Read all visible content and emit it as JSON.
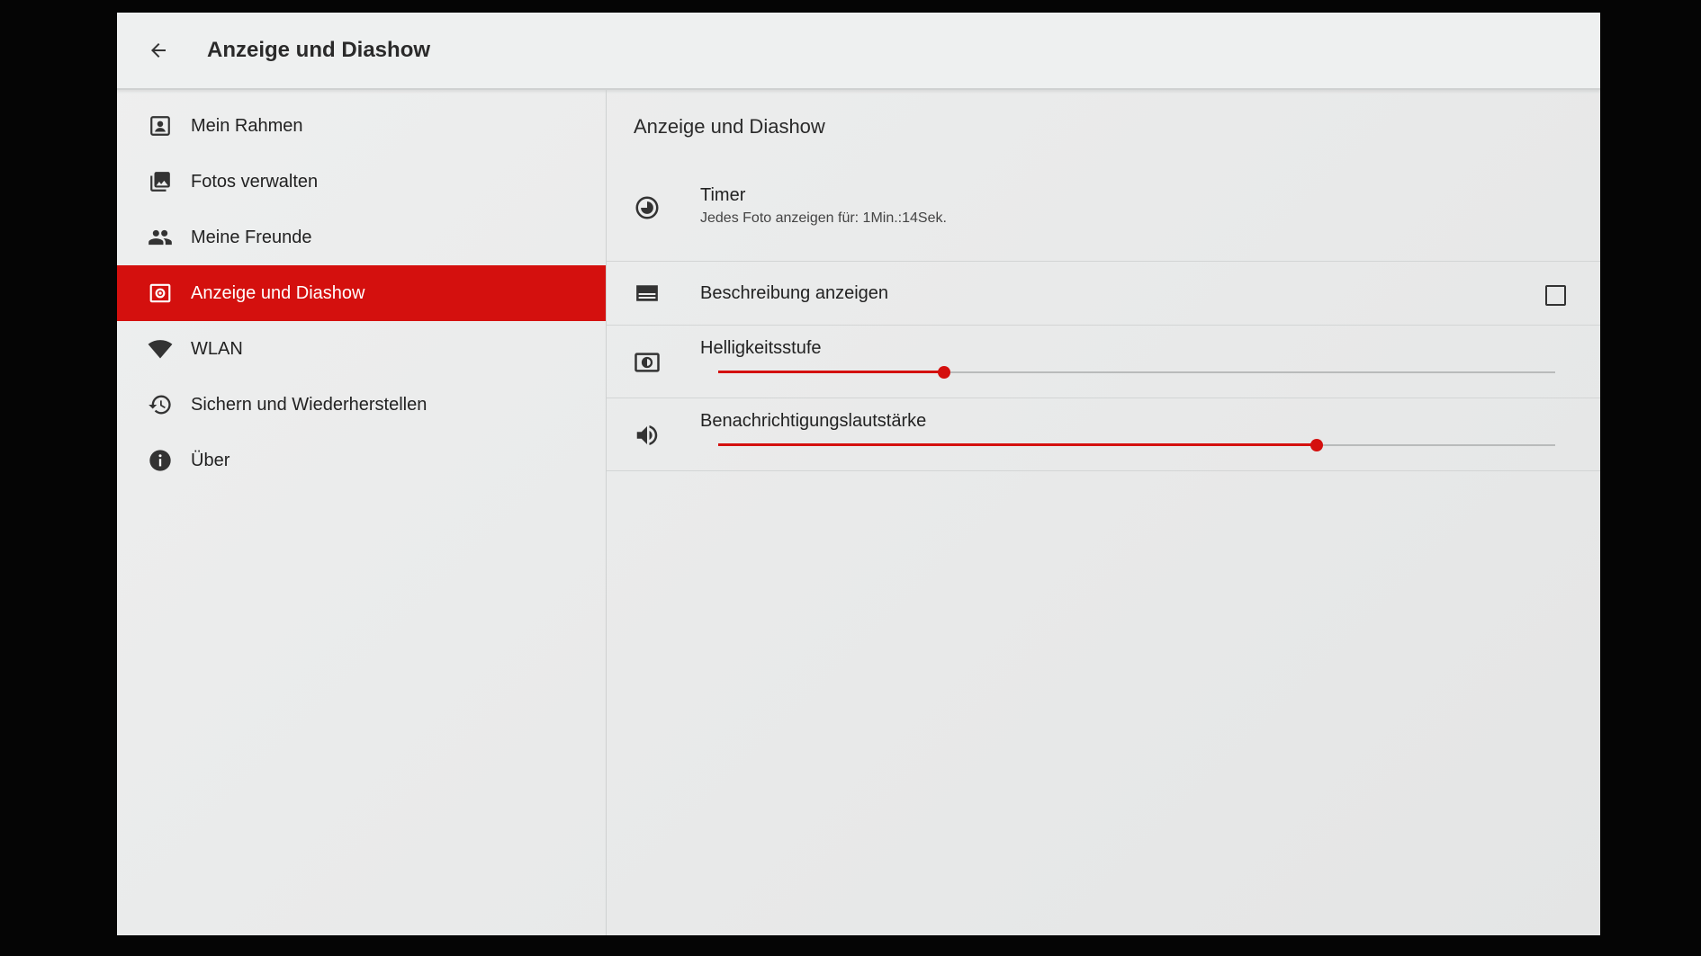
{
  "header": {
    "title": "Anzeige und Diashow"
  },
  "sidebar": {
    "items": [
      {
        "label": "Mein Rahmen",
        "icon": "portrait-frame-icon"
      },
      {
        "label": "Fotos verwalten",
        "icon": "photo-library-icon"
      },
      {
        "label": "Meine Freunde",
        "icon": "people-icon"
      },
      {
        "label": "Anzeige und Diashow",
        "icon": "display-settings-icon",
        "active": true
      },
      {
        "label": "WLAN",
        "icon": "wifi-icon"
      },
      {
        "label": "Sichern und Wiederherstellen",
        "icon": "backup-restore-icon"
      },
      {
        "label": "Über",
        "icon": "info-icon"
      }
    ]
  },
  "main": {
    "section_title": "Anzeige und Diashow",
    "timer": {
      "title": "Timer",
      "subtitle": "Jedes Foto anzeigen für: 1Min.:14Sek.",
      "icon": "timer-icon"
    },
    "description": {
      "title": "Beschreibung anzeigen",
      "checked": false,
      "icon": "subtitles-icon"
    },
    "brightness": {
      "title": "Helligkeitsstufe",
      "level": 0.27,
      "icon": "brightness-icon"
    },
    "notification_volume": {
      "title": "Benachrichtigungslautstärke",
      "level": 0.715,
      "icon": "volume-icon"
    }
  },
  "colors": {
    "accent": "#d4100e",
    "background": "#ebecec",
    "text": "#222222"
  }
}
